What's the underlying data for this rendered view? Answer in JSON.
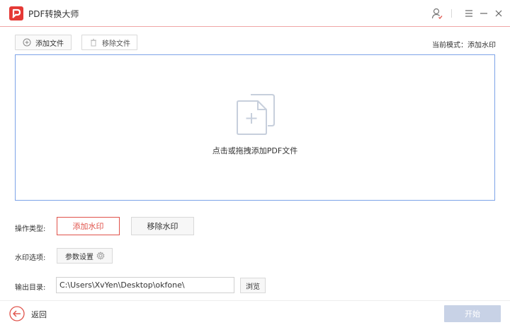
{
  "app": {
    "title": "PDF转换大师",
    "logo_letter": "P",
    "brand_color": "#e53935"
  },
  "window_controls": {
    "user_icon": "user-icon",
    "menu_icon": "menu-icon",
    "minimize_icon": "minimize-icon",
    "close_icon": "close-icon"
  },
  "toolbar": {
    "add_file_label": "添加文件",
    "remove_file_label": "移除文件",
    "mode_label": "当前模式：添加水印"
  },
  "dropzone": {
    "hint": "点击或拖拽添加PDF文件"
  },
  "options": {
    "op_type_label": "操作类型:",
    "op_add_watermark": "添加水印",
    "op_remove_watermark": "移除水印",
    "selected_op": "添加水印",
    "watermark_options_label": "水印选项:",
    "param_settings_label": "参数设置",
    "output_dir_label": "输出目录:",
    "output_dir_value": "C:\\Users\\XvYen\\Desktop\\okfone\\",
    "browse_label": "浏览"
  },
  "footer": {
    "back_label": "返回",
    "start_label": "开始"
  },
  "colors": {
    "accent_red": "#e0524a",
    "dropzone_border": "#7da3e8",
    "start_disabled": "#c8d2e6"
  }
}
